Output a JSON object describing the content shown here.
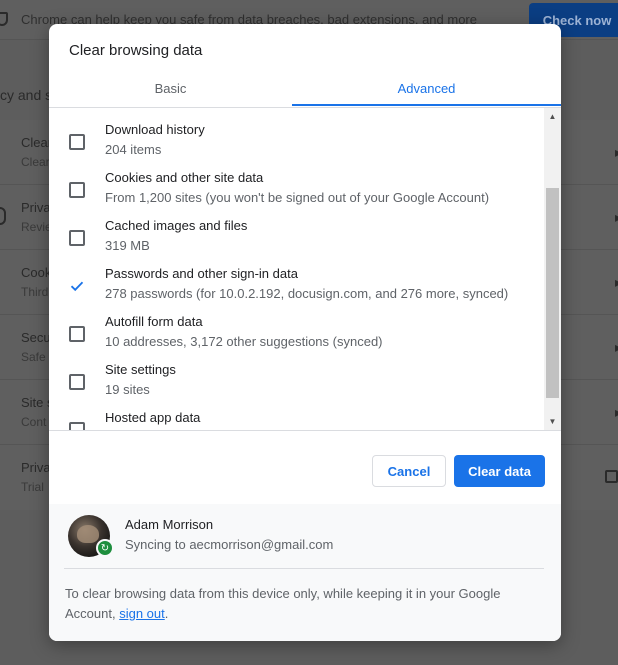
{
  "background": {
    "banner_text": "Chrome can help keep you safe from data breaches, bad extensions, and more",
    "check_now_label": "Check now",
    "section_title": "cy and s",
    "rows": [
      {
        "title": "Clear",
        "sub": "Clear"
      },
      {
        "title": "Priva",
        "sub": "Revie"
      },
      {
        "title": "Cook",
        "sub": "Third"
      },
      {
        "title": "Secu",
        "sub": "Safe"
      },
      {
        "title": "Site s",
        "sub": "Cont"
      },
      {
        "title": "Priva",
        "sub": "Trial"
      }
    ]
  },
  "dialog": {
    "title": "Clear browsing data",
    "tabs": [
      {
        "label": "Basic",
        "active": false
      },
      {
        "label": "Advanced",
        "active": true
      }
    ],
    "items": [
      {
        "label": "Download history",
        "sub": "204 items",
        "checked": false
      },
      {
        "label": "Cookies and other site data",
        "sub": "From 1,200 sites (you won't be signed out of your Google Account)",
        "checked": false
      },
      {
        "label": "Cached images and files",
        "sub": "319 MB",
        "checked": false
      },
      {
        "label": "Passwords and other sign-in data",
        "sub": "278 passwords (for 10.0.2.192, docusign.com, and 276 more, synced)",
        "checked": true
      },
      {
        "label": "Autofill form data",
        "sub": "10 addresses, 3,172 other suggestions (synced)",
        "checked": false
      },
      {
        "label": "Site settings",
        "sub": "19 sites",
        "checked": false
      },
      {
        "label": "Hosted app data",
        "sub": "",
        "checked": false
      }
    ],
    "cancel_label": "Cancel",
    "clear_label": "Clear data",
    "account": {
      "name": "Adam Morrison",
      "sync_text": "Syncing to aecmorrison@gmail.com"
    },
    "note_prefix": "To clear browsing data from this device only, while keeping it in your Google Account, ",
    "note_link": "sign out",
    "note_suffix": "."
  },
  "colors": {
    "accent": "#1a73e8",
    "sync_badge": "#1e8e3e"
  }
}
